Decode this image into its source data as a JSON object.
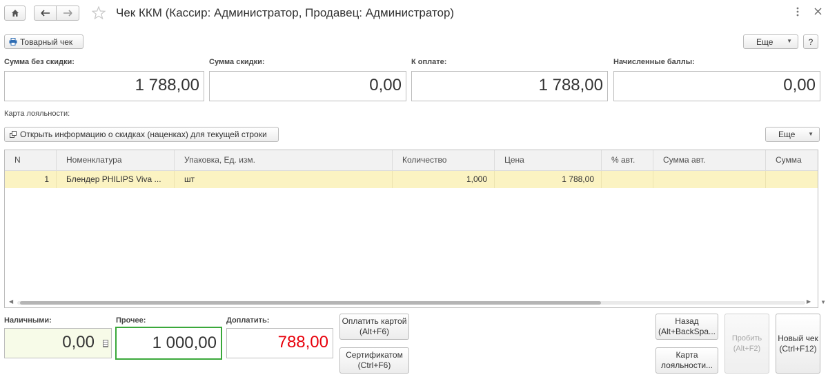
{
  "toolbar": {
    "home_icon": "home-icon",
    "back_icon": "arrow-left-icon",
    "forward_icon": "arrow-right-icon",
    "favorite_icon": "star-icon",
    "title": "Чек ККМ (Кассир: Администратор, Продавец: Администратор)",
    "more_icon": "vertical-dots-icon",
    "close_icon": "close-icon"
  },
  "commands": {
    "receipt_label": "Товарный чек",
    "more_label": "Еще",
    "help_label": "?"
  },
  "totals": {
    "sum_no_discount_label": "Сумма без скидки:",
    "sum_no_discount_value": "1 788,00",
    "discount_label": "Сумма скидки:",
    "discount_value": "0,00",
    "to_pay_label": "К оплате:",
    "to_pay_value": "1 788,00",
    "points_label": "Начисленные баллы:",
    "points_value": "0,00"
  },
  "loyalty": {
    "label": "Карта лояльности:"
  },
  "discount_info": {
    "button_label": "Открыть информацию о скидках (наценках) для текущей строки",
    "more_label": "Еще"
  },
  "table": {
    "columns": [
      "N",
      "Номенклатура",
      "Упаковка, Ед. изм.",
      "Количество",
      "Цена",
      "% авт.",
      "Сумма авт.",
      "Сумма"
    ],
    "rows": [
      [
        "1",
        "Блендер PHILIPS Viva ...",
        "шт",
        "1,000",
        "1 788,00",
        "",
        "",
        ""
      ]
    ]
  },
  "payment": {
    "cash_label": "Наличными:",
    "cash_value": "0,00",
    "other_label": "Прочее:",
    "other_value": "1 000,00",
    "due_label": "Доплатить:",
    "due_value": "788,00",
    "due_color": "#e8000b",
    "pay_card_label": "Оплатить картой\n(Alt+F6)",
    "certificate_label": "Сертификатом\n(Ctrl+F6)",
    "back_label": "Назад\n(Alt+BackSpa...",
    "loyalty_card_label": "Карта\nлояльности...",
    "print_label": "Пробить\n(Alt+F2)",
    "new_receipt_label": "Новый чек\n(Ctrl+F12)"
  },
  "colors": {
    "cash_field_bg": "#f7fbe8",
    "other_field_border": "#3aa83a",
    "selected_row_bg": "#fbf3c2"
  }
}
